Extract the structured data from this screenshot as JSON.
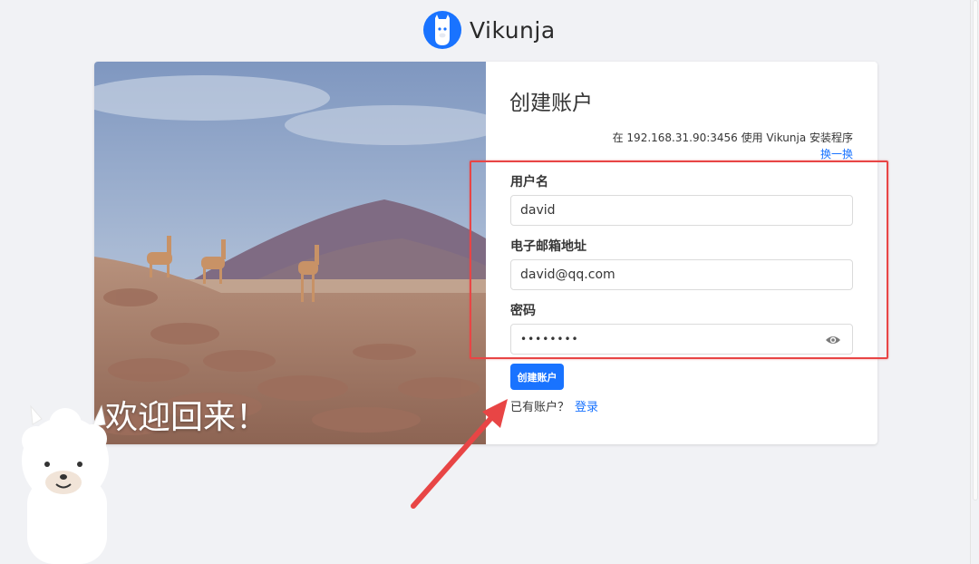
{
  "app": {
    "name": "Vikunja"
  },
  "hero": {
    "welcome_text": "欢迎回来！"
  },
  "register": {
    "title": "创建账户",
    "server_info": "在 192.168.31.90:3456 使用 Vikunja 安装程序",
    "change_server_link": "换一换",
    "username_label": "用户名",
    "username_value": "david",
    "email_label": "电子邮箱地址",
    "email_value": "david@qq.com",
    "password_label": "密码",
    "password_value": "••••••••",
    "submit_label": "创建账户",
    "have_account_text": "已有账户？",
    "login_link": "登录"
  },
  "icons": {
    "logo": "llama-logo-icon",
    "eye": "eye-icon",
    "mascot": "llama-mascot-icon"
  },
  "colors": {
    "accent": "#1973ff",
    "annotation": "#e84545",
    "background": "#f1f2f5"
  }
}
